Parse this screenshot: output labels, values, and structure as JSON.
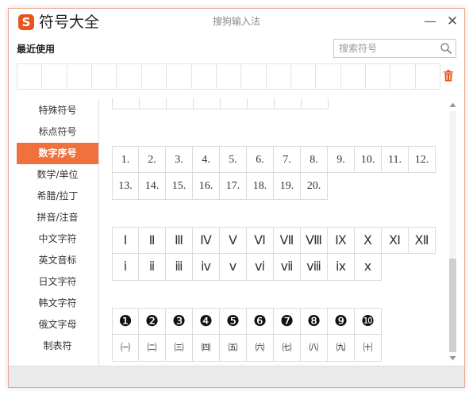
{
  "window": {
    "logo_glyph": "S",
    "title": "符号大全",
    "subtitle": "搜狗输入法",
    "minimize_glyph": "—",
    "close_glyph": "✕"
  },
  "recent": {
    "label": "最近使用"
  },
  "search": {
    "placeholder": "搜索符号"
  },
  "categories": [
    {
      "label": "特殊符号"
    },
    {
      "label": "标点符号"
    },
    {
      "label": "数字序号",
      "active": true
    },
    {
      "label": "数学/单位"
    },
    {
      "label": "希腊/拉丁"
    },
    {
      "label": "拼音/注音"
    },
    {
      "label": "中文字符"
    },
    {
      "label": "英文音标"
    },
    {
      "label": "日文字符"
    },
    {
      "label": "韩文字符"
    },
    {
      "label": "俄文字母"
    },
    {
      "label": "制表符"
    }
  ],
  "symbols": {
    "numbered_period": [
      "1.",
      "2.",
      "3.",
      "4.",
      "5.",
      "6.",
      "7.",
      "8.",
      "9.",
      "10.",
      "11.",
      "12.",
      "13.",
      "14.",
      "15.",
      "16.",
      "17.",
      "18.",
      "19.",
      "20."
    ],
    "roman_upper": [
      "Ⅰ",
      "Ⅱ",
      "Ⅲ",
      "Ⅳ",
      "Ⅴ",
      "Ⅵ",
      "Ⅶ",
      "Ⅷ",
      "Ⅸ",
      "Ⅹ",
      "Ⅺ",
      "Ⅻ"
    ],
    "roman_lower": [
      "ⅰ",
      "ⅱ",
      "ⅲ",
      "ⅳ",
      "ⅴ",
      "ⅵ",
      "ⅶ",
      "ⅷ",
      "ⅸ",
      "ⅹ"
    ],
    "circled_filled": [
      "❶",
      "❷",
      "❸",
      "❹",
      "❺",
      "❻",
      "❼",
      "❽",
      "❾",
      "❿"
    ],
    "paren_chinese": [
      "㈠",
      "㈡",
      "㈢",
      "㈣",
      "㈤",
      "㈥",
      "㈦",
      "㈧",
      "㈨",
      "㈩"
    ]
  },
  "colors": {
    "accent": "#f0703e",
    "logo": "#e8541e",
    "trash": "#e8541e"
  }
}
